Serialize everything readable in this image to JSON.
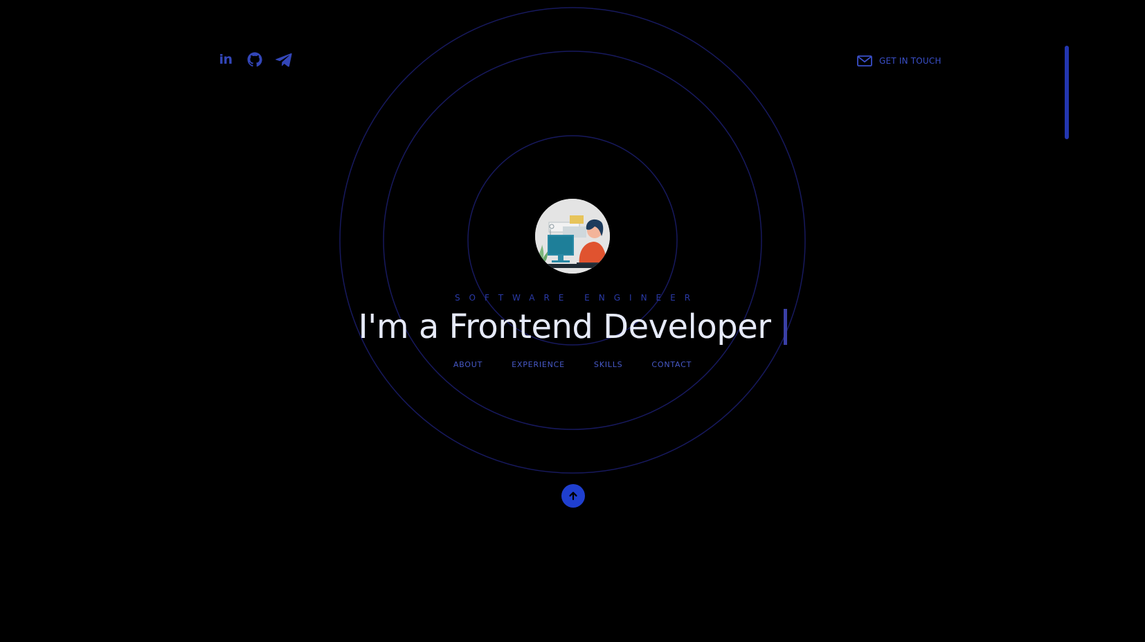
{
  "header": {
    "socials": [
      {
        "name": "linkedin-icon",
        "glyph": "in"
      },
      {
        "name": "github-icon"
      },
      {
        "name": "telegram-icon"
      }
    ],
    "contact_label": "GET IN TOUCH",
    "contact_icon": "mail-icon"
  },
  "hero": {
    "subtitle": "SOFTWARE ENGINEER",
    "headline": "I'm a Frontend Developer",
    "avatar_alt": "developer-illustration"
  },
  "nav": {
    "items": [
      "ABOUT",
      "EXPERIENCE",
      "SKILLS",
      "CONTACT"
    ]
  },
  "back_to_top_icon": "arrow-up-icon",
  "colors": {
    "background": "#000000",
    "accent": "#1f3fcf",
    "ring": "#1b1d6e",
    "headline": "#e6eaf8"
  }
}
